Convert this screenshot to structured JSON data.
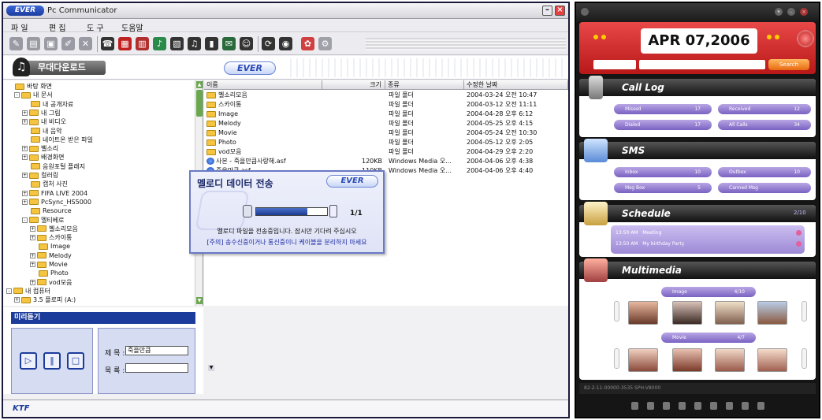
{
  "left_window": {
    "title": "Pc Communicator",
    "logo": "EVER",
    "menu": [
      "파 일",
      "편 집",
      "도 구",
      "도움말"
    ],
    "banner_title": "무대다운로드",
    "banner_logo": "EVER",
    "tree": [
      {
        "label": "바탕 화면",
        "indent": 0,
        "expander": ""
      },
      {
        "label": "내 문서",
        "indent": 1,
        "expander": "-"
      },
      {
        "label": "내 공개자료",
        "indent": 2,
        "expander": ""
      },
      {
        "label": "내 그림",
        "indent": 2,
        "expander": "+"
      },
      {
        "label": "내 비디오",
        "indent": 2,
        "expander": "+"
      },
      {
        "label": "내 음악",
        "indent": 2,
        "expander": ""
      },
      {
        "label": "네이트온 받은 파일",
        "indent": 2,
        "expander": ""
      },
      {
        "label": "벨소리",
        "indent": 2,
        "expander": "+"
      },
      {
        "label": "배경화면",
        "indent": 2,
        "expander": "+"
      },
      {
        "label": "음원포털 플래지",
        "indent": 2,
        "expander": ""
      },
      {
        "label": "컬러링",
        "indent": 2,
        "expander": "+"
      },
      {
        "label": "캡처 사진",
        "indent": 2,
        "expander": ""
      },
      {
        "label": "FIFA LIVE 2004",
        "indent": 2,
        "expander": "+"
      },
      {
        "label": "PcSync_HS5000",
        "indent": 2,
        "expander": "+"
      },
      {
        "label": "Resource",
        "indent": 2,
        "expander": ""
      },
      {
        "label": "멜티베로",
        "indent": 2,
        "expander": "-"
      },
      {
        "label": "벨소리모음",
        "indent": 3,
        "expander": "+"
      },
      {
        "label": "스카이통",
        "indent": 3,
        "expander": "+"
      },
      {
        "label": "Image",
        "indent": 3,
        "expander": ""
      },
      {
        "label": "Melody",
        "indent": 3,
        "expander": "+"
      },
      {
        "label": "Movie",
        "indent": 3,
        "expander": "+"
      },
      {
        "label": "Photo",
        "indent": 3,
        "expander": ""
      },
      {
        "label": "vod모음",
        "indent": 3,
        "expander": "+"
      },
      {
        "label": "내 컴퓨터",
        "indent": 0,
        "expander": "-"
      },
      {
        "label": "3.5 플로피 (A:)",
        "indent": 1,
        "expander": "+"
      }
    ],
    "file_columns": [
      "이름",
      "크기",
      "종류",
      "수정한 날짜"
    ],
    "files": [
      {
        "name": "벨소리모음",
        "size": "",
        "type": "파일 폴더",
        "date": "2004-03-24 오전 10:47",
        "kind": "folder"
      },
      {
        "name": "스카이통",
        "size": "",
        "type": "파일 폴더",
        "date": "2004-03-12 오전 11:11",
        "kind": "folder"
      },
      {
        "name": "Image",
        "size": "",
        "type": "파일 폴더",
        "date": "2004-04-28 오후 6:12",
        "kind": "folder"
      },
      {
        "name": "Melody",
        "size": "",
        "type": "파일 폴더",
        "date": "2004-05-25 오후 4:15",
        "kind": "folder"
      },
      {
        "name": "Movie",
        "size": "",
        "type": "파일 폴더",
        "date": "2004-05-24 오전 10:30",
        "kind": "folder"
      },
      {
        "name": "Photo",
        "size": "",
        "type": "파일 폴더",
        "date": "2004-05-12 오후 2:05",
        "kind": "folder"
      },
      {
        "name": "vod모음",
        "size": "",
        "type": "파일 폴더",
        "date": "2004-04-29 오후 2:20",
        "kind": "folder"
      },
      {
        "name": "사본 - 죽을만큼사랑해.asf",
        "size": "120KB",
        "type": "Windows Media 오...",
        "date": "2004-04-06 오후 4:38",
        "kind": "media"
      },
      {
        "name": "죽을만큼.asf",
        "size": "110KB",
        "type": "Windows Media 오...",
        "date": "2004-04-06 오후 4:40",
        "kind": "media"
      }
    ],
    "dialog": {
      "title": "멜로디 데이터 전송",
      "logo": "EVER",
      "progress": 0.72,
      "count": "1/1",
      "message": "멜로디 파일을 전송중입니다. 잠시만 기다려 주십시오",
      "warning": "[주의] 송수신중이거나 통신중이니 케이블을 분리하지 마세요"
    },
    "preview": {
      "header": "미리듣기",
      "title_label": "제 목 :",
      "title_value": "죽을만큼",
      "list_label": "목 록 :",
      "list_value": "",
      "buttons": [
        "▷",
        "‖",
        "□"
      ]
    },
    "status_brand": "KTF"
  },
  "phone": {
    "date": "APR 07,2006",
    "search_label": "Search",
    "sections": [
      {
        "title": "Call Log"
      },
      {
        "title": "SMS"
      },
      {
        "title": "Schedule"
      },
      {
        "title": "Multimedia"
      }
    ],
    "call_log": [
      {
        "label": "Missed",
        "value": "17"
      },
      {
        "label": "Received",
        "value": "12"
      },
      {
        "label": "Dialed",
        "value": "17"
      },
      {
        "label": "All Calls",
        "value": "34"
      }
    ],
    "sms": [
      {
        "label": "Inbox",
        "value": "10"
      },
      {
        "label": "Outbox",
        "value": "10"
      },
      {
        "label": "Msg Box",
        "value": "5"
      },
      {
        "label": "Canned Msg",
        "value": ""
      }
    ],
    "schedule": {
      "count": "2/10",
      "items": [
        {
          "time": "13:50 AM",
          "text": "Meeting"
        },
        {
          "time": "13:50 AM",
          "text": "My birthday Party"
        }
      ]
    },
    "multimedia": {
      "image_label": "Image",
      "image_count": "4/10",
      "movie_label": "Movie",
      "movie_count": "4/7"
    },
    "status": "82-2-11-00000-3535        SPH-V8000"
  },
  "colors": {
    "accent": "#1c3c9c",
    "phone_red": "#c82020",
    "pill": "#8e77cf"
  }
}
